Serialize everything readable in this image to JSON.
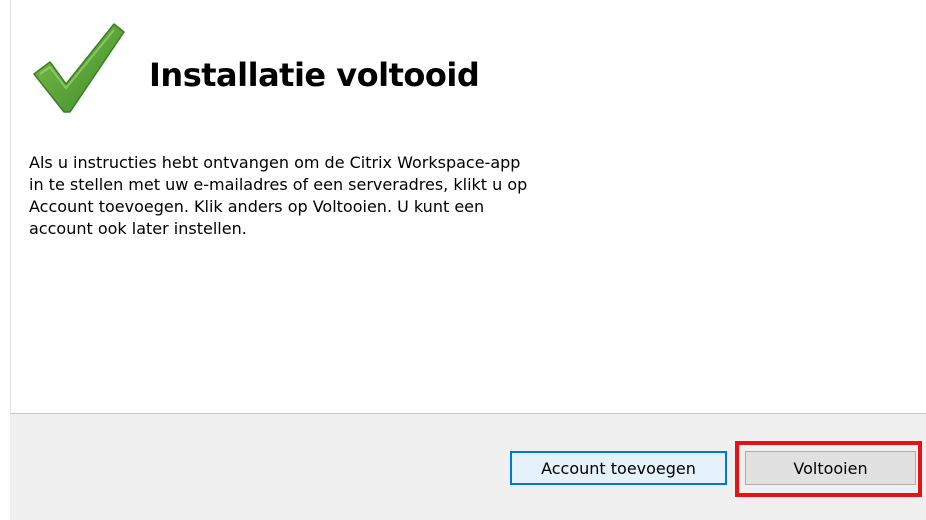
{
  "dialog": {
    "title": "Installatie voltooid",
    "message_lines": [
      "Als u instructies hebt ontvangen om de Citrix Workspace-app",
      "in te stellen met uw e-mailadres of een serveradres, klikt u op",
      "Account toevoegen. Klik anders op Voltooien. U kunt een",
      "account ook later instellen."
    ],
    "icon": "checkmark-icon"
  },
  "buttons": {
    "add_account_label": "Account toevoegen",
    "finish_label": "Voltooien"
  },
  "colors": {
    "check_green": "#5aa032",
    "footer_bg": "#f0f0f0",
    "focus_blue": "#0078d7",
    "highlight_red": "#e51414"
  }
}
